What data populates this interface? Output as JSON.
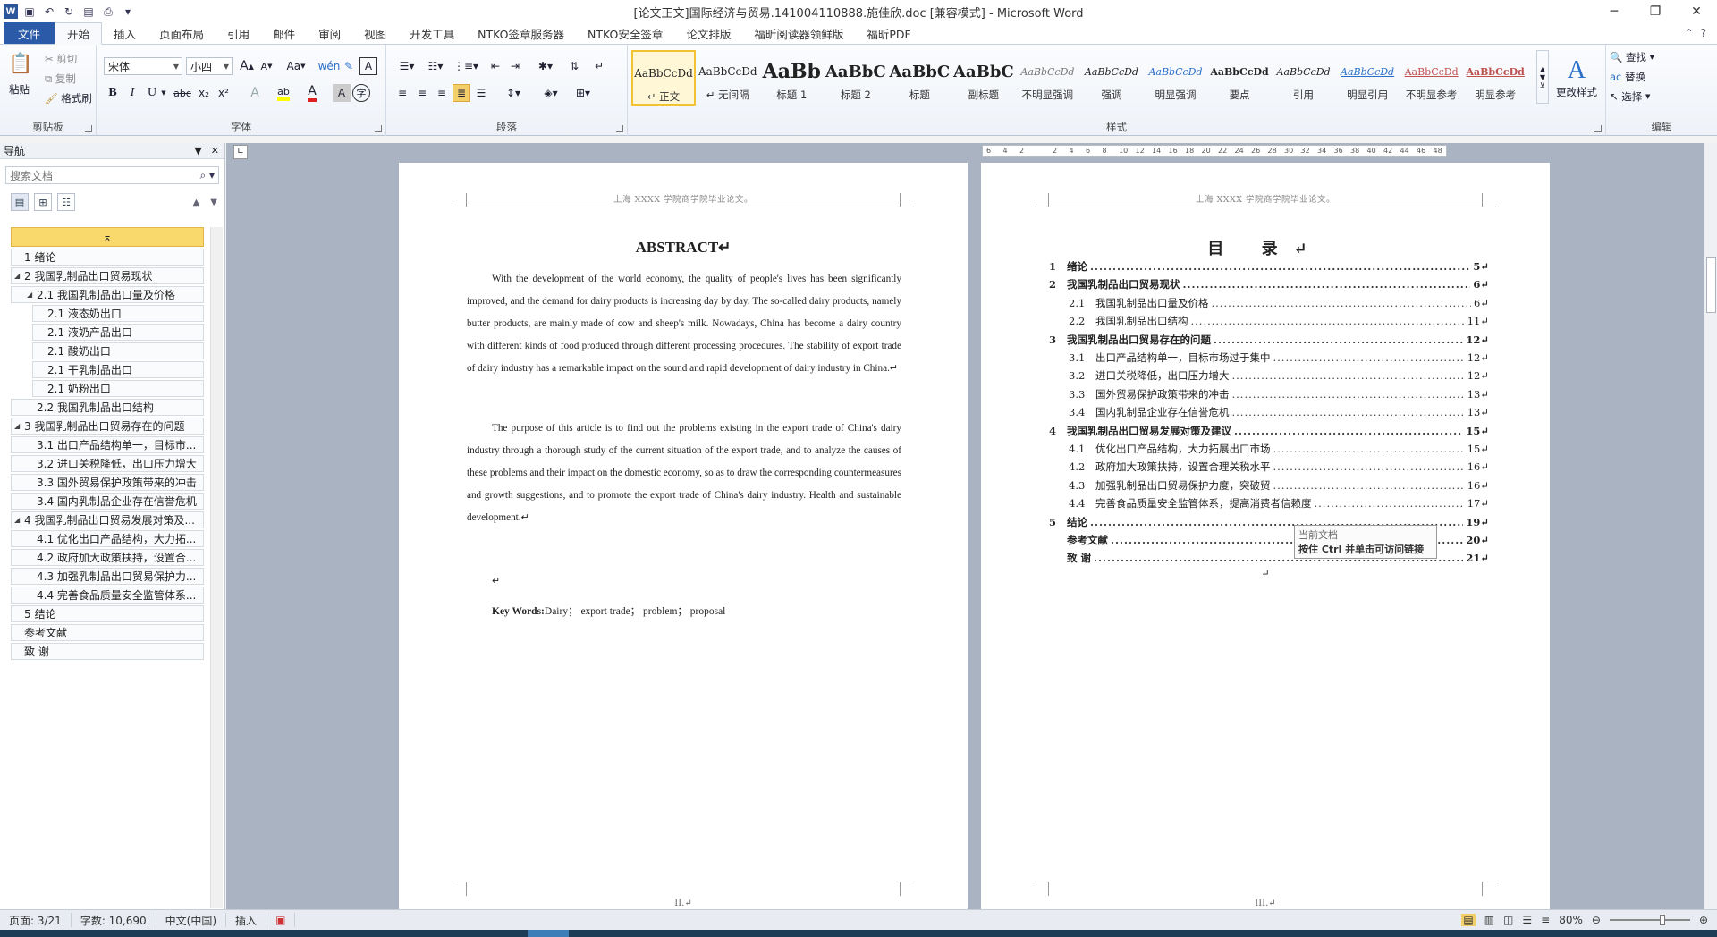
{
  "window": {
    "title": "[论文正文]国际经济与贸易.141004110888.施佳欣.doc [兼容模式] - Microsoft Word",
    "app_icon": "W",
    "controls": [
      "minimize",
      "restore",
      "close"
    ]
  },
  "tabs": [
    "文件",
    "开始",
    "插入",
    "页面布局",
    "引用",
    "邮件",
    "审阅",
    "视图",
    "开发工具",
    "NTKO签章服务器",
    "NTKO安全签章",
    "论文排版",
    "福昕阅读器领鲜版",
    "福昕PDF"
  ],
  "active_tab": "开始",
  "ribbon": {
    "clipboard": {
      "label": "剪贴板",
      "paste": "粘贴",
      "cut": "剪切",
      "copy": "复制",
      "format_painter": "格式刷"
    },
    "font": {
      "label": "字体",
      "font_name": "宋体",
      "font_size": "小四",
      "bold": "B",
      "italic": "I",
      "underline": "U",
      "strike": "abc",
      "subscript": "x₂",
      "superscript": "x²",
      "grow": "A",
      "shrink": "A",
      "change_case": "Aa",
      "clear": "A",
      "highlight": "ab",
      "font_color": "A"
    },
    "paragraph": {
      "label": "段落"
    },
    "styles": {
      "label": "样式",
      "items": [
        {
          "sample": "AaBbCcDd",
          "name": "↵ 正文",
          "selected": true
        },
        {
          "sample": "AaBbCcDd",
          "name": "↵ 无间隔"
        },
        {
          "sample": "AaBb",
          "name": "标题 1"
        },
        {
          "sample": "AaBbC",
          "name": "标题 2"
        },
        {
          "sample": "AaBbC",
          "name": "标题"
        },
        {
          "sample": "AaBbC",
          "name": "副标题"
        },
        {
          "sample": "AaBbCcDd",
          "name": "不明显强调"
        },
        {
          "sample": "AaBbCcDd",
          "name": "强调"
        },
        {
          "sample": "AaBbCcDd",
          "name": "明显强调"
        },
        {
          "sample": "AaBbCcDd",
          "name": "要点"
        },
        {
          "sample": "AaBbCcDd",
          "name": "引用"
        },
        {
          "sample": "AaBbCcDd",
          "name": "明显引用"
        },
        {
          "sample": "AaBbCcDd",
          "name": "不明显参考"
        },
        {
          "sample": "AaBbCcDd",
          "name": "明显参考"
        }
      ],
      "change_styles": "更改样式"
    },
    "editing": {
      "label": "编辑",
      "find": "查找",
      "replace": "替换",
      "select": "选择"
    }
  },
  "nav": {
    "title": "导航",
    "search_placeholder": "搜索文档",
    "items": [
      {
        "text": "",
        "level": 0,
        "top": true
      },
      {
        "text": "1 绪论",
        "level": 1
      },
      {
        "text": "2 我国乳制品出口贸易现状",
        "level": 1,
        "expanded": true
      },
      {
        "text": "2.1 我国乳制品出口量及价格",
        "level": 2,
        "expanded": true
      },
      {
        "text": "2.1 液态奶出口",
        "level": 3
      },
      {
        "text": "2.1 液奶产品出口",
        "level": 3
      },
      {
        "text": "2.1 酸奶出口",
        "level": 3
      },
      {
        "text": "2.1 干乳制品出口",
        "level": 3
      },
      {
        "text": "2.1 奶粉出口",
        "level": 3
      },
      {
        "text": "2.2 我国乳制品出口结构",
        "level": 2
      },
      {
        "text": "3 我国乳制品出口贸易存在的问题",
        "level": 1,
        "expanded": true
      },
      {
        "text": "3.1 出口产品结构单一，目标市...",
        "level": 2
      },
      {
        "text": "3.2 进口关税降低，出口压力增大",
        "level": 2
      },
      {
        "text": "3.3 国外贸易保护政策带来的冲击",
        "level": 2
      },
      {
        "text": "3.4 国内乳制品企业存在信誉危机",
        "level": 2
      },
      {
        "text": "4 我国乳制品出口贸易发展对策及...",
        "level": 1,
        "expanded": true
      },
      {
        "text": "4.1 优化出口产品结构，大力拓...",
        "level": 2
      },
      {
        "text": "4.2 政府加大政策扶持，设置合...",
        "level": 2
      },
      {
        "text": "4.3 加强乳制品出口贸易保护力...",
        "level": 2
      },
      {
        "text": "4.4 完善食品质量安全监管体系...",
        "level": 2
      },
      {
        "text": "5 结论",
        "level": 1
      },
      {
        "text": "参考文献",
        "level": 1
      },
      {
        "text": "致  谢",
        "level": 1
      }
    ]
  },
  "page_left": {
    "header": "上海 XXXX 学院商学院毕业论文。",
    "title": "ABSTRACT↵",
    "para1": "With the development of the world economy, the quality of people's lives has been significantly improved, and the demand for dairy products is increasing day by day. The so-called dairy products, namely butter products, are mainly made of cow and sheep's milk. Nowadays, China has become a dairy country with different kinds of food produced through different processing procedures. The stability of export trade of dairy industry has a remarkable impact on the sound and rapid development of dairy industry in China.↵",
    "para2": "The purpose of this article is to find out the problems existing in the export trade of China's dairy industry through a thorough study of the current situation of the export trade, and to analyze the causes of these problems and their impact on the domestic economy, so as to draw the corresponding countermeasures and growth suggestions, and to promote the export trade of China's dairy industry. Health and sustainable development.↵",
    "blank": "↵",
    "keywords_label": "Key Words:",
    "keywords": "Dairy； export trade； problem； proposal",
    "footer": "II.↵"
  },
  "page_right": {
    "header": "上海 XXXX 学院商学院毕业论文。",
    "title": "目    录↵",
    "toc": [
      {
        "num": "1",
        "text": "绪论",
        "page": "5↵",
        "level": 1
      },
      {
        "num": "2",
        "text": "我国乳制品出口贸易现状",
        "page": "6↵",
        "level": 1
      },
      {
        "num": "2.1",
        "text": "我国乳制品出口量及价格",
        "page": "6↵",
        "level": 2
      },
      {
        "num": "2.2",
        "text": "我国乳制品出口结构",
        "page": "11↵",
        "level": 2
      },
      {
        "num": "3",
        "text": "我国乳制品出口贸易存在的问题",
        "page": "12↵",
        "level": 1
      },
      {
        "num": "3.1",
        "text": "出口产品结构单一，目标市场过于集中",
        "page": "12↵",
        "level": 2
      },
      {
        "num": "3.2",
        "text": "进口关税降低，出口压力增大",
        "page": "12↵",
        "level": 2
      },
      {
        "num": "3.3",
        "text": "国外贸易保护政策带来的冲击",
        "page": "13↵",
        "level": 2
      },
      {
        "num": "3.4",
        "text": "国内乳制品企业存在信誉危机",
        "page": "13↵",
        "level": 2
      },
      {
        "num": "4",
        "text": "我国乳制品出口贸易发展对策及建议",
        "page": "15↵",
        "level": 1
      },
      {
        "num": "4.1",
        "text": "优化出口产品结构，大力拓展出口市场",
        "page": "15↵",
        "level": 2
      },
      {
        "num": "4.2",
        "text": "政府加大政策扶持，设置合理关税水平",
        "page": "16↵",
        "level": 2
      },
      {
        "num": "4.3",
        "text": "加强乳制品出口贸易保护力度，突破贸",
        "page": "16↵",
        "level": 2
      },
      {
        "num": "4.4",
        "text": "完善食品质量安全监管体系，提高消费者信赖度",
        "page": "17↵",
        "level": 2
      },
      {
        "num": "5",
        "text": "结论",
        "page": "19↵",
        "level": 1
      },
      {
        "num": "",
        "text": "参考文献",
        "page": "20↵",
        "level": 1
      },
      {
        "num": "",
        "text": "致    谢",
        "page": "21↵",
        "level": 1
      }
    ],
    "end_mark": "↵",
    "footer": "III.↵"
  },
  "tooltip": {
    "line1": "当前文档",
    "line2": "按住 Ctrl 并单击可访问链接"
  },
  "ruler_ticks": [
    "6",
    "4",
    "2",
    "",
    "2",
    "4",
    "6",
    "8",
    "10",
    "12",
    "14",
    "16",
    "18",
    "20",
    "22",
    "24",
    "26",
    "28",
    "30",
    "32",
    "34",
    "36",
    "38",
    "40",
    "42",
    "44",
    "46",
    "48"
  ],
  "status": {
    "page": "页面: 3/21",
    "words": "字数: 10,690",
    "language": "中文(中国)",
    "mode": "插入",
    "zoom": "80%"
  },
  "colors": {
    "file_tab": "#2a5aa8",
    "nav_top": "#f9d96c",
    "doc_bg": "#a9b3c1"
  }
}
